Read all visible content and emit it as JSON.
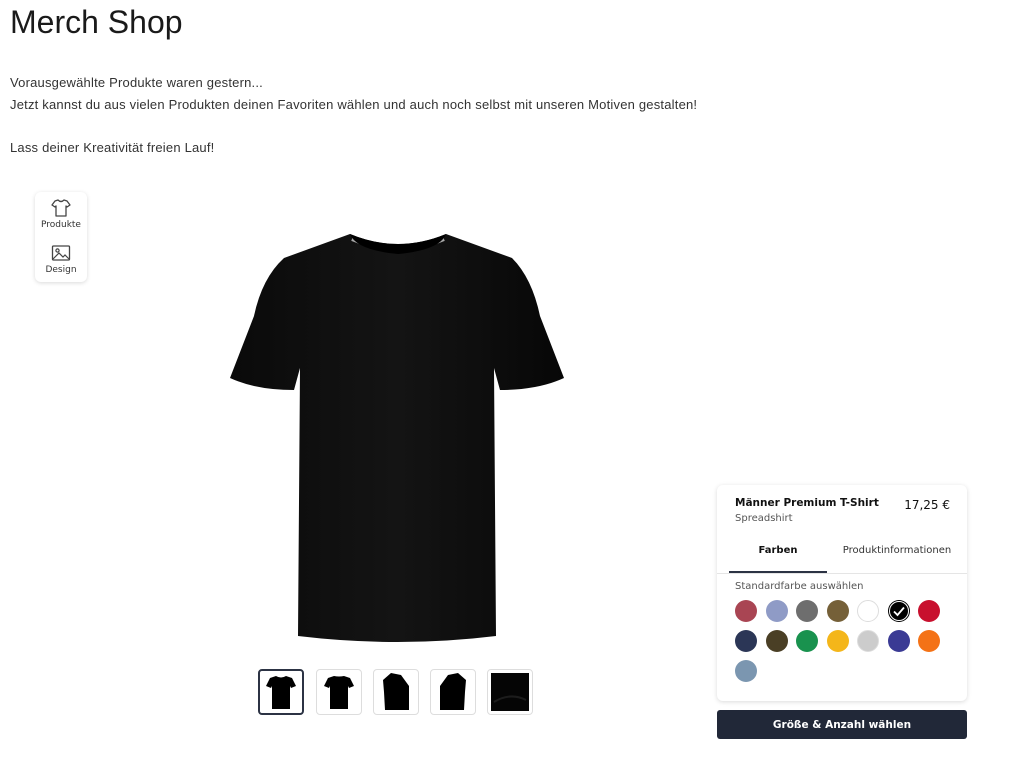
{
  "page": {
    "title": "Merch Shop",
    "intro_line1": "Vorausgewählte Produkte waren gestern...",
    "intro_line2": "Jetzt kannst du aus vielen Produkten deinen Favoriten wählen und auch noch selbst mit unseren Motiven gestalten!",
    "intro_line3": "Lass deiner Kreativität freien Lauf!"
  },
  "toolbar": {
    "products_label": "Produkte",
    "products_icon": "tshirt-icon",
    "design_label": "Design",
    "design_icon": "image-icon"
  },
  "product": {
    "name": "Männer Premium T-Shirt",
    "brand": "Spreadshirt",
    "price": "17,25 €",
    "selected_color": "#000000",
    "views": [
      "front",
      "back",
      "left-sleeve",
      "right-sleeve",
      "detail"
    ],
    "active_view": "front"
  },
  "tabs": {
    "colors": "Farben",
    "info": "Produktinformationen",
    "active": "colors"
  },
  "colors": {
    "label": "Standardfarbe auswählen",
    "swatches": [
      "#a94553",
      "#8f9bc6",
      "#6e6e6e",
      "#756038",
      "#ffffff",
      "#000000",
      "#c8102e",
      "#2b3656",
      "#4a3f25",
      "#19924e",
      "#f4b61a",
      "#cccccc",
      "#3a3a94",
      "#f47216",
      "#7b96b0"
    ]
  },
  "cta": {
    "label": "Größe & Anzahl wählen"
  }
}
